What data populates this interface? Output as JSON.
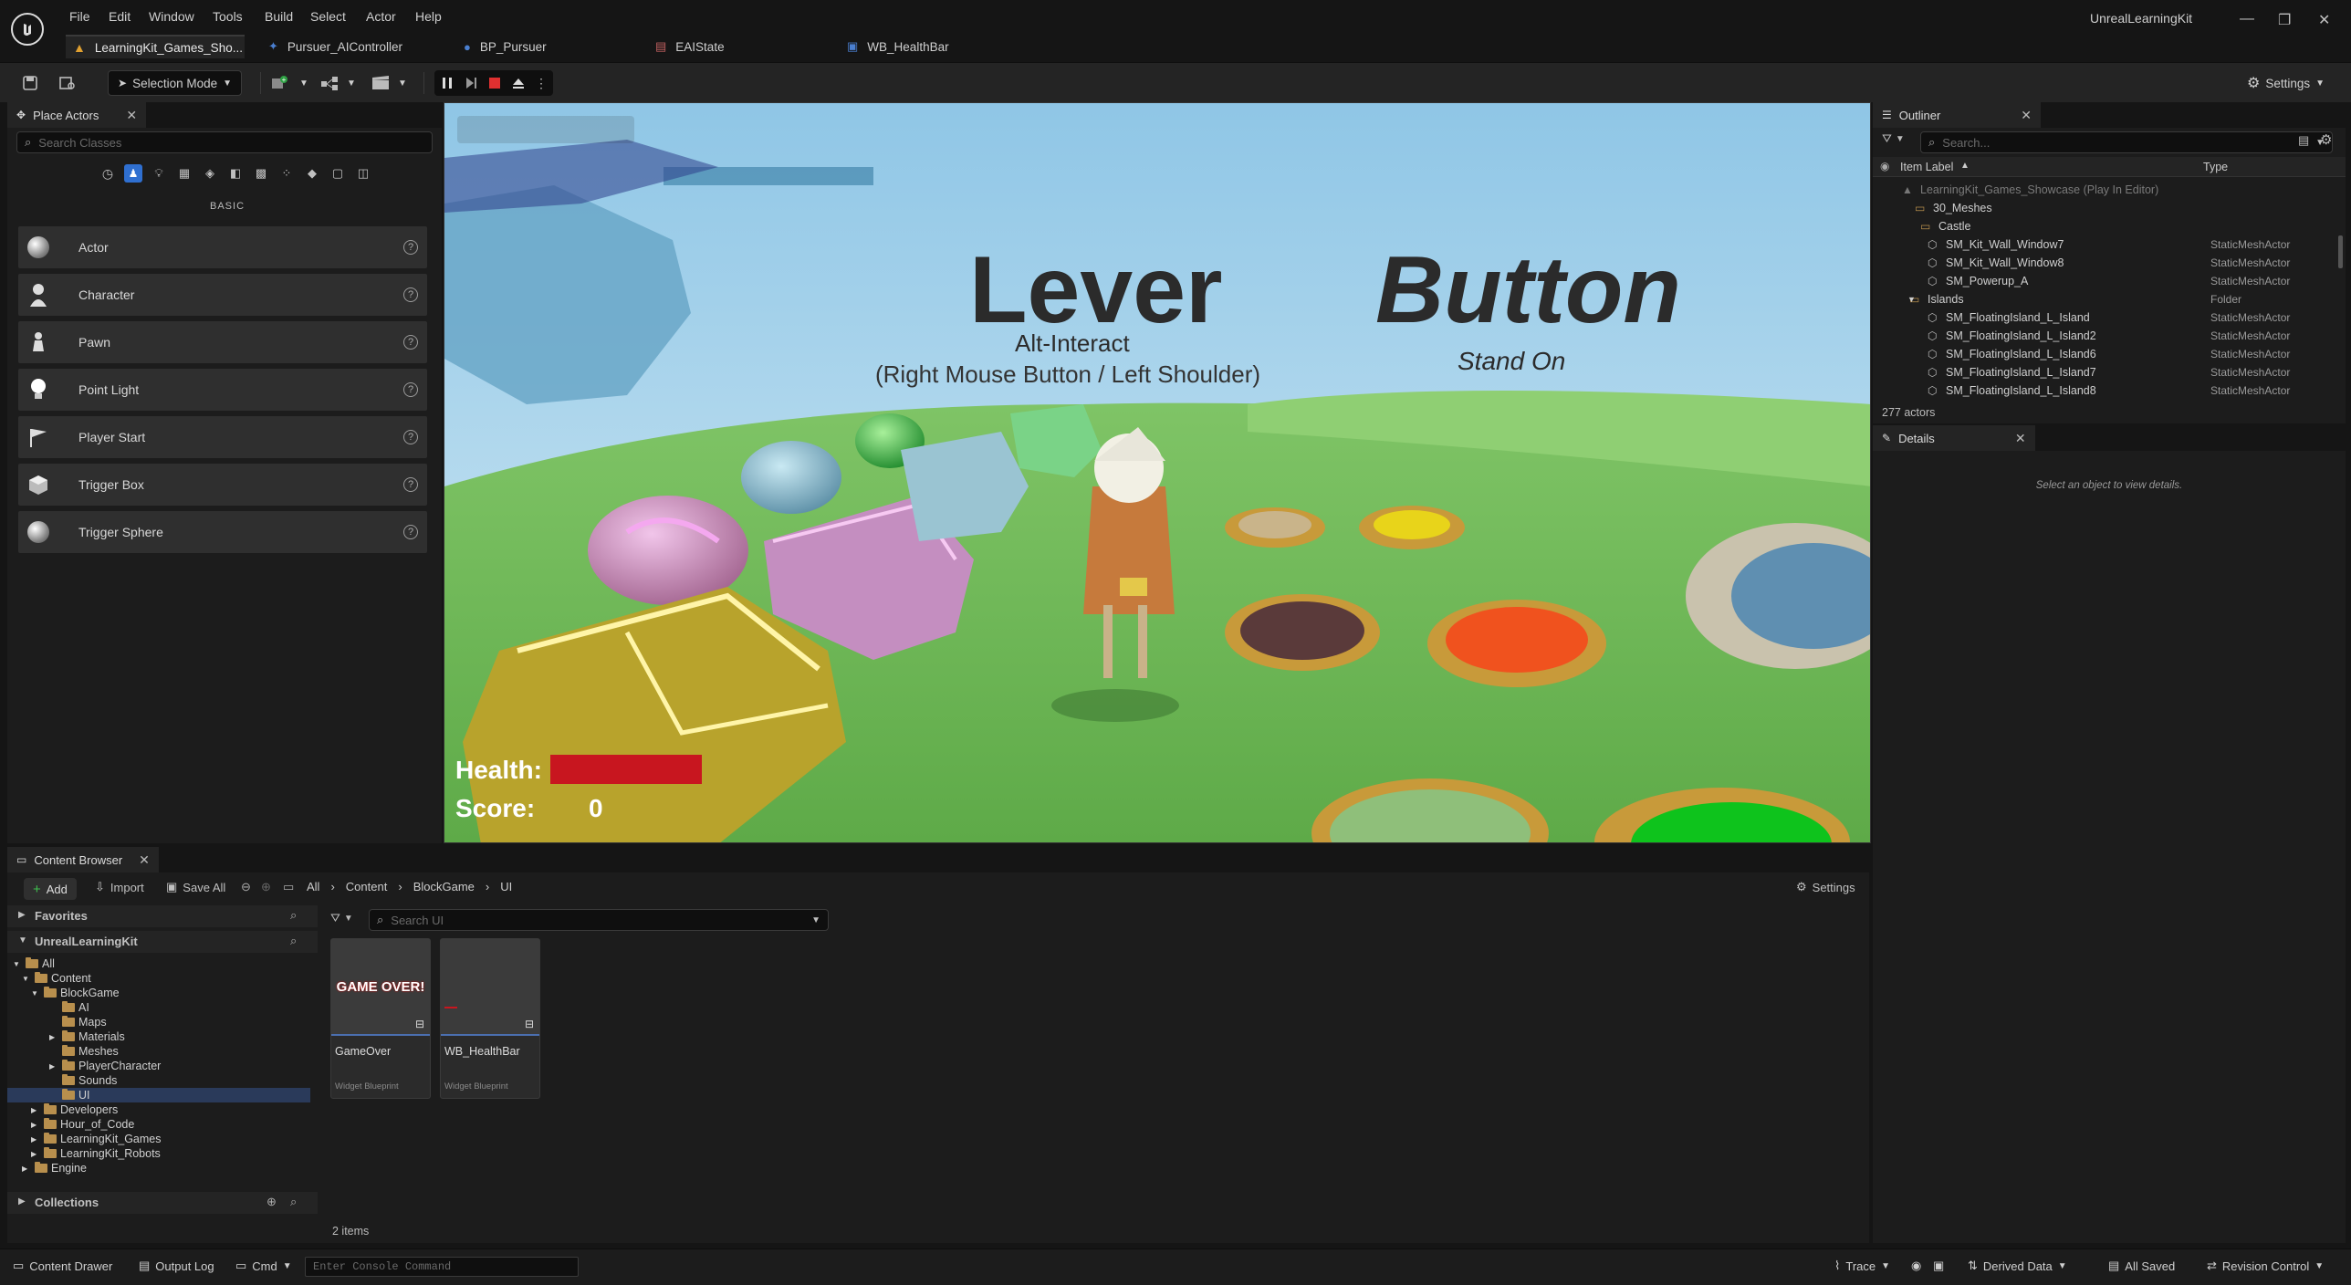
{
  "menu": [
    "File",
    "Edit",
    "Window",
    "Tools",
    "Build",
    "Select",
    "Actor",
    "Help"
  ],
  "project_name": "UnrealLearningKit",
  "tabs": [
    {
      "label": "LearningKit_Games_Sho...",
      "icon": "level-icon",
      "color": "#e0a030"
    },
    {
      "label": "Pursuer_AIController",
      "icon": "controller-icon",
      "color": "#4a7fd0"
    },
    {
      "label": "BP_Pursuer",
      "icon": "blueprint-icon",
      "color": "#4a7fd0"
    },
    {
      "label": "EAIState",
      "icon": "enum-icon",
      "color": "#c06060"
    },
    {
      "label": "WB_HealthBar",
      "icon": "widget-icon",
      "color": "#4a7fd0"
    }
  ],
  "toolbar": {
    "mode": "Selection Mode",
    "settings": "Settings"
  },
  "place_actors": {
    "title": "Place Actors",
    "search_placeholder": "Search Classes",
    "category": "BASIC",
    "items": [
      "Actor",
      "Character",
      "Pawn",
      "Point Light",
      "Player Start",
      "Trigger Box",
      "Trigger Sphere"
    ]
  },
  "viewport": {
    "sign_lever": "Lever",
    "sign_lever_sub": "Alt-Interact",
    "sign_lever_sub2": "(Right Mouse Button / Left Shoulder)",
    "sign_button": "Button",
    "sign_button_sub": "Stand On",
    "hud_health_label": "Health:",
    "hud_score_label": "Score:",
    "hud_score_value": "0",
    "health_fraction": 1.0
  },
  "outliner": {
    "title": "Outliner",
    "search_placeholder": "Search...",
    "col_label": "Item Label",
    "col_type": "Type",
    "rows": [
      {
        "label": "LearningKit_Games_Showcase (Play In Editor)",
        "type": "",
        "kind": "level"
      },
      {
        "label": "30_Meshes",
        "type": "",
        "kind": "folder"
      },
      {
        "label": "Castle",
        "type": "",
        "kind": "folder"
      },
      {
        "label": "SM_Kit_Wall_Window7",
        "type": "StaticMeshActor",
        "kind": "mesh"
      },
      {
        "label": "SM_Kit_Wall_Window8",
        "type": "StaticMeshActor",
        "kind": "mesh"
      },
      {
        "label": "SM_Powerup_A",
        "type": "StaticMeshActor",
        "kind": "mesh"
      },
      {
        "label": "Islands",
        "type": "Folder",
        "kind": "folder"
      },
      {
        "label": "SM_FloatingIsland_L_Island",
        "type": "StaticMeshActor",
        "kind": "mesh"
      },
      {
        "label": "SM_FloatingIsland_L_Island2",
        "type": "StaticMeshActor",
        "kind": "mesh"
      },
      {
        "label": "SM_FloatingIsland_L_Island6",
        "type": "StaticMeshActor",
        "kind": "mesh"
      },
      {
        "label": "SM_FloatingIsland_L_Island7",
        "type": "StaticMeshActor",
        "kind": "mesh"
      },
      {
        "label": "SM_FloatingIsland_L_Island8",
        "type": "StaticMeshActor",
        "kind": "mesh"
      }
    ],
    "count": "277 actors"
  },
  "details": {
    "title": "Details",
    "empty_msg": "Select an object to view details."
  },
  "content_browser": {
    "title": "Content Browser",
    "add": "Add",
    "import": "Import",
    "save_all": "Save All",
    "breadcrumb": [
      "All",
      "Content",
      "BlockGame",
      "UI"
    ],
    "settings": "Settings",
    "search_placeholder": "Search UI",
    "favorites": "Favorites",
    "project": "UnrealLearningKit",
    "tree": [
      "All",
      "Content",
      "BlockGame",
      "AI",
      "Maps",
      "Materials",
      "Meshes",
      "PlayerCharacter",
      "Sounds",
      "UI",
      "Developers",
      "Hour_of_Code",
      "LearningKit_Games",
      "LearningKit_Robots",
      "Engine"
    ],
    "collections": "Collections",
    "assets": [
      {
        "name": "GameOver",
        "type": "Widget Blueprint",
        "thumb_text": "GAME OVER!"
      },
      {
        "name": "WB_HealthBar",
        "type": "Widget Blueprint",
        "thumb_text": ""
      }
    ],
    "item_count": "2 items"
  },
  "statusbar": {
    "content_drawer": "Content Drawer",
    "output_log": "Output Log",
    "cmd": "Cmd",
    "console_placeholder": "Enter Console Command",
    "trace": "Trace",
    "derived_data": "Derived Data",
    "all_saved": "All Saved",
    "revision_control": "Revision Control"
  }
}
